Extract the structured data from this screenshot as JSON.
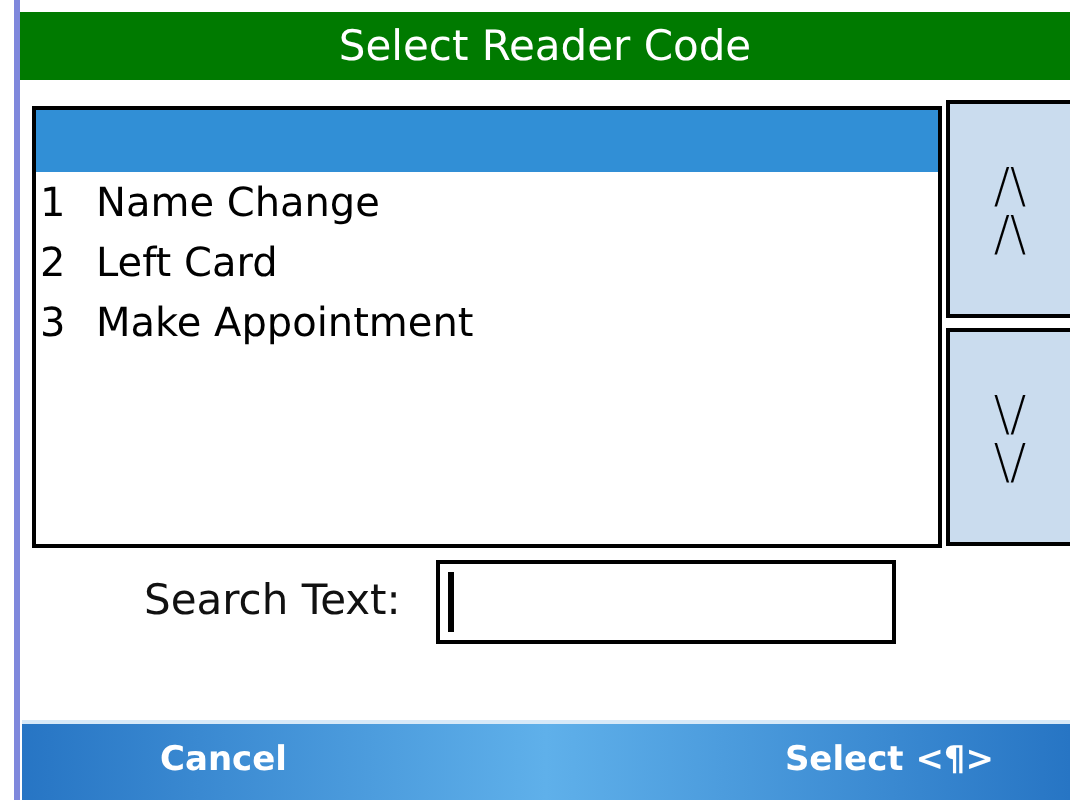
{
  "window": {
    "title": "Select Reader Code"
  },
  "list": {
    "blank_row_selected": true,
    "items": [
      {
        "number": "1",
        "label": "Name Change",
        "selected": false
      },
      {
        "number": "2",
        "label": "Left Card",
        "selected": false
      },
      {
        "number": "3",
        "label": "Make Appointment",
        "selected": false
      }
    ]
  },
  "scroll_buttons": [
    {
      "lines": [
        "/\\",
        "/\\"
      ]
    },
    {
      "lines": [
        "\\/",
        "\\/"
      ]
    }
  ],
  "search": {
    "label": "Search Text:",
    "focused": true
  },
  "softkeys": [
    "Cancel",
    "Select <¶>"
  ]
}
